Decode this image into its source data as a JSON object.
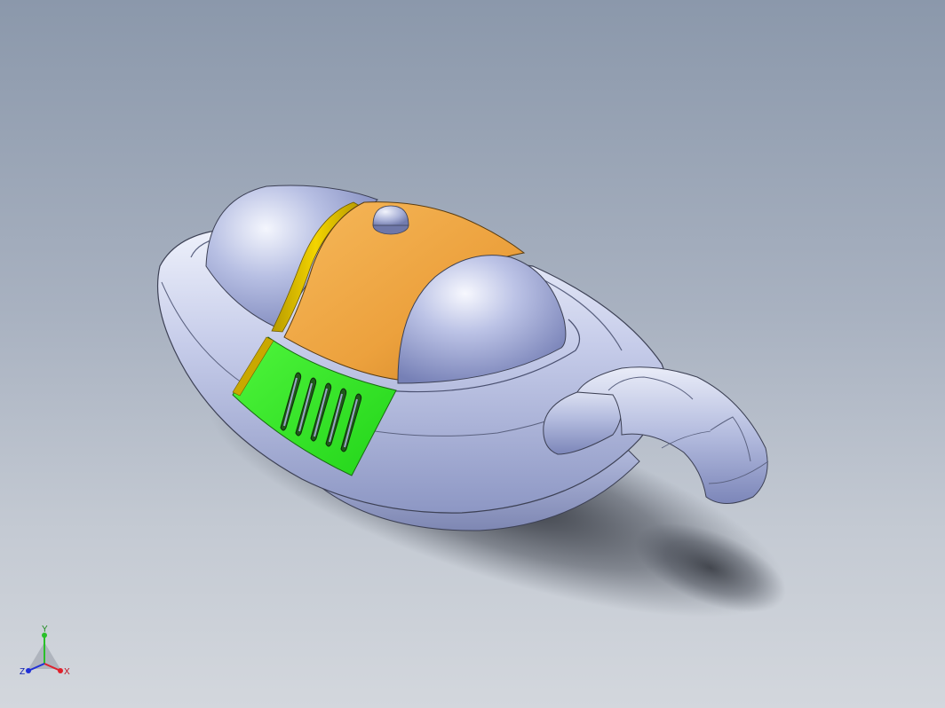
{
  "colors": {
    "background_top": "#8b98ab",
    "background_bottom": "#d3d7dd",
    "body_silver": "#a9b4dc",
    "panel_orange": "#f0a23c",
    "vent_green": "#35e628",
    "seam_yellow": "#e8c400",
    "axis_x": "#e0202c",
    "axis_y": "#2ac02a",
    "axis_z": "#2030d8"
  },
  "triad": {
    "x_label": "X",
    "y_label": "Y",
    "z_label": "Z"
  },
  "model": {
    "vent_slot_count": 5
  }
}
